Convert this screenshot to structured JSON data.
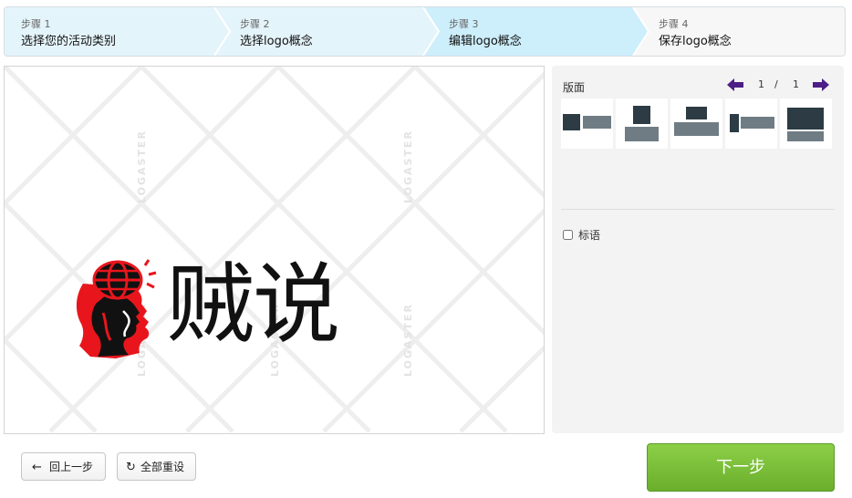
{
  "steps": [
    {
      "num": "步骤 1",
      "label": "选择您的活动类别"
    },
    {
      "num": "步骤 2",
      "label": "选择logo概念"
    },
    {
      "num": "步骤 3",
      "label": "编辑logo概念"
    },
    {
      "num": "步骤 4",
      "label": "保存logo概念"
    }
  ],
  "canvas": {
    "watermark": "LOGASTER",
    "logo_text": "贼说",
    "logo_icon": "head-globe-icon"
  },
  "panel": {
    "layout_title": "版面",
    "pager": {
      "current": "1",
      "separator": "/",
      "total": "1"
    },
    "slogan_label": "标语",
    "slogan_checked": false
  },
  "buttons": {
    "back_label": "回上一步",
    "reset_label": "全部重设",
    "next_label": "下一步"
  },
  "colors": {
    "step_active": "#cdeefb",
    "step_done": "#e4f4fb",
    "step_todo": "#f7f7f7",
    "next_green": "#78bd38",
    "logo_red": "#e8161c"
  }
}
